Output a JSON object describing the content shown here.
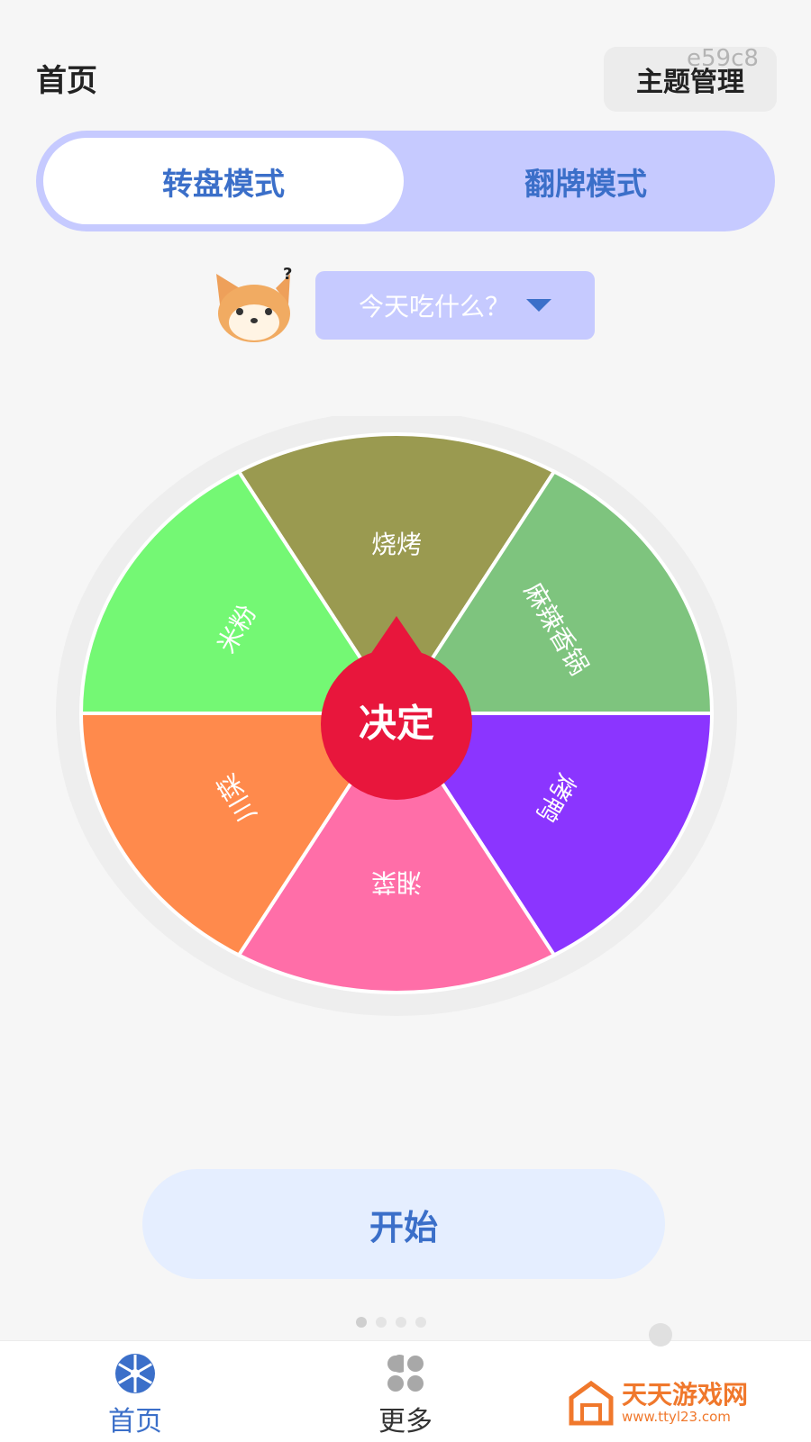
{
  "header": {
    "title": "首页",
    "theme_button": "主题管理",
    "watermark": "e59c8"
  },
  "mode_switch": {
    "tabs": [
      {
        "label": "转盘模式",
        "active": true
      },
      {
        "label": "翻牌模式",
        "active": false
      }
    ]
  },
  "topic": {
    "mascot_icon": "shiba-dog-icon",
    "selected": "今天吃什么？"
  },
  "wheel": {
    "center_label": "决定",
    "center_color": "#e8163c",
    "segments": [
      {
        "label": "烧烤",
        "color": "#9a9a50"
      },
      {
        "label": "麻辣香锅",
        "color": "#7ec47e"
      },
      {
        "label": "烤鸭",
        "color": "#8b35ff"
      },
      {
        "label": "湘菜",
        "color": "#ff6ea8"
      },
      {
        "label": "川菜",
        "color": "#ff8a4c"
      },
      {
        "label": "米粉",
        "color": "#74f874"
      }
    ]
  },
  "start_button": "开始",
  "bottom_nav": {
    "items": [
      {
        "label": "首页",
        "icon": "wheel-icon",
        "active": true
      },
      {
        "label": "更多",
        "icon": "grid-icon",
        "active": false
      }
    ]
  },
  "branding": {
    "name": "天天游戏网",
    "url": "www.ttyl23.com"
  },
  "colors": {
    "accent": "#3b6fc9",
    "switch_bg": "#c6caff",
    "start_bg": "#e5eeff"
  }
}
